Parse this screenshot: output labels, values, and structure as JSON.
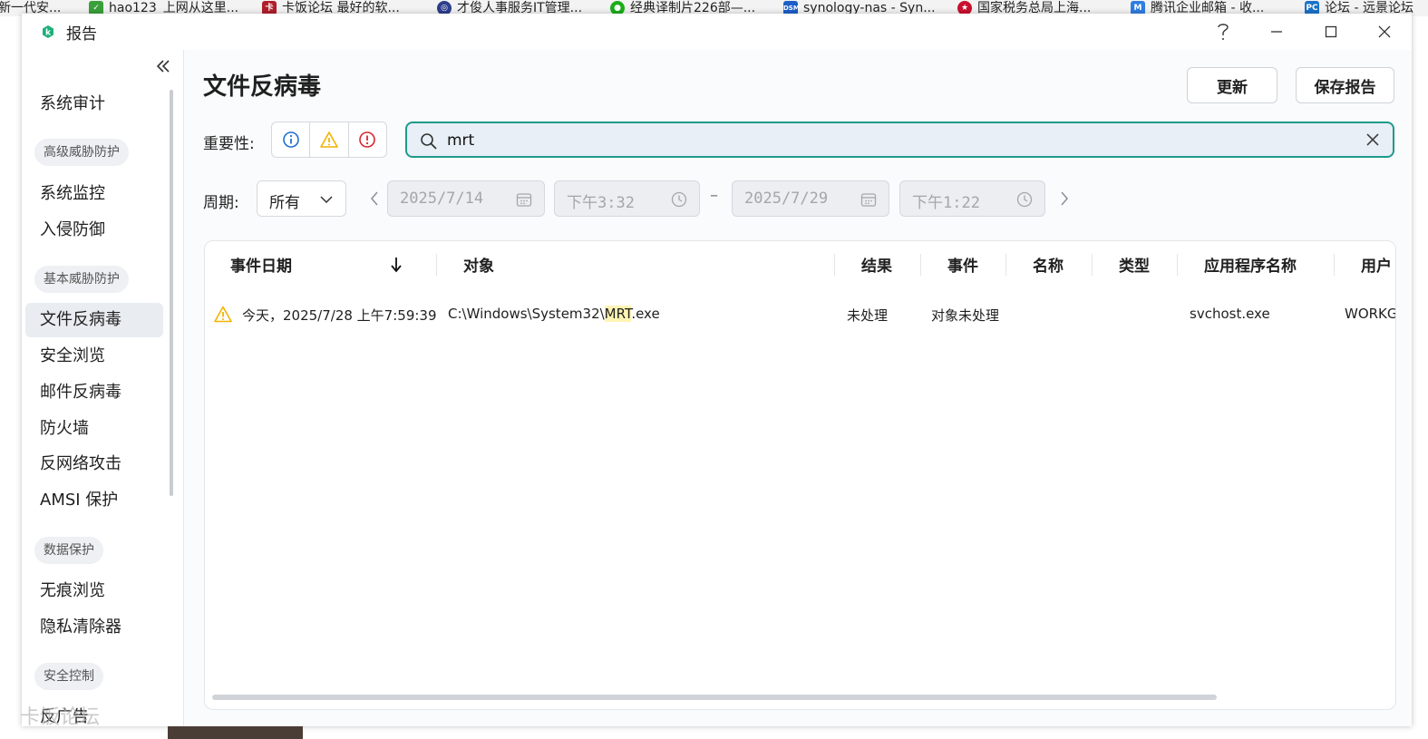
{
  "bookmarks": [
    {
      "label": "新一代安..."
    },
    {
      "label": "hao123_上网从这里..."
    },
    {
      "label": "卡饭论坛 最好的软..."
    },
    {
      "label": "才俊人事服务IT管理..."
    },
    {
      "label": "经典译制片226部—..."
    },
    {
      "label": "synology-nas - Syn..."
    },
    {
      "label": "国家税务总局上海..."
    },
    {
      "label": "腾讯企业邮箱 - 收..."
    },
    {
      "label": "论坛 - 远景论坛"
    }
  ],
  "window": {
    "title": "报告"
  },
  "sidebar": {
    "items": [
      {
        "label": "系统审计"
      },
      {
        "label": "高级威胁防护"
      },
      {
        "label": "系统监控"
      },
      {
        "label": "入侵防御"
      },
      {
        "label": "基本威胁防护"
      },
      {
        "label": "文件反病毒"
      },
      {
        "label": "安全浏览"
      },
      {
        "label": "邮件反病毒"
      },
      {
        "label": "防火墙"
      },
      {
        "label": "反网络攻击"
      },
      {
        "label": "AMSI 保护"
      },
      {
        "label": "数据保护"
      },
      {
        "label": "无痕浏览"
      },
      {
        "label": "隐私清除器"
      },
      {
        "label": "安全控制"
      },
      {
        "label": "反广告"
      }
    ]
  },
  "main": {
    "title": "文件反病毒",
    "update_label": "更新",
    "save_report_label": "保存报告",
    "severity_label": "重要性:",
    "search": {
      "value": "mrt"
    },
    "period_label": "周期:",
    "period_value": "所有",
    "start_date": "2025/7/14",
    "start_time": "下午3:32",
    "range_sep": "–",
    "end_date": "2025/7/29",
    "end_time": "下午1:22"
  },
  "table": {
    "columns": [
      {
        "label": "事件日期"
      },
      {
        "label": "对象"
      },
      {
        "label": "结果"
      },
      {
        "label": "事件"
      },
      {
        "label": "名称"
      },
      {
        "label": "类型"
      },
      {
        "label": "应用程序名称"
      },
      {
        "label": "用户"
      }
    ],
    "rows": [
      {
        "date": "今天，2025/7/28 上午7:59:39",
        "object_prefix": "C:\\Windows\\System32\\",
        "object_match": "MRT",
        "object_suffix": ".exe",
        "result": "未处理",
        "event": "对象未处理",
        "name": "",
        "type": "",
        "app": "svchost.exe",
        "user": "WORKG"
      }
    ]
  },
  "watermark": "卡饭论坛",
  "colors": {
    "accent": "#1e9a8c",
    "warning": "#f0b400",
    "info": "#1f6fd1",
    "error": "#d9262c"
  }
}
